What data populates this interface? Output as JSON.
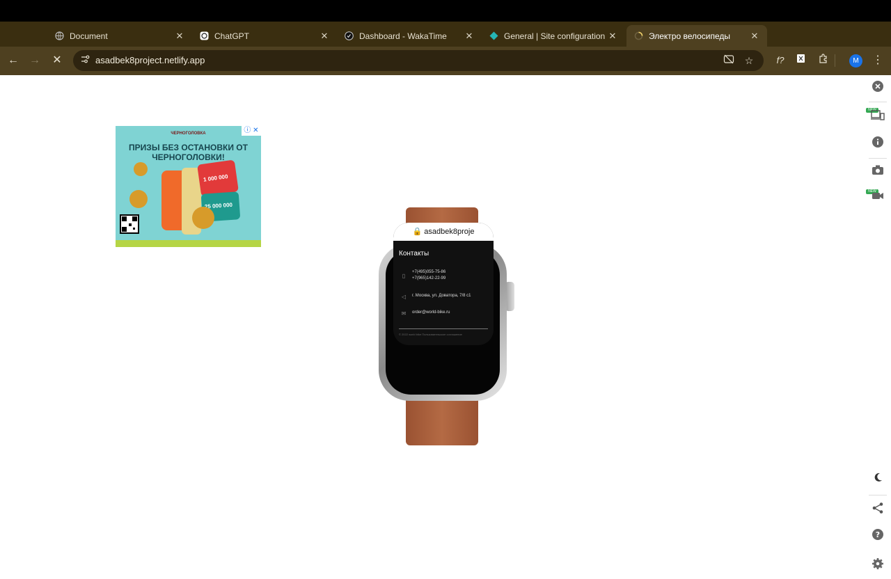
{
  "browser": {
    "tabs": [
      {
        "title": "Document",
        "icon": "globe-icon"
      },
      {
        "title": "ChatGPT",
        "icon": "chatgpt-icon"
      },
      {
        "title": "Dashboard - WakaTime",
        "icon": "wakatime-icon"
      },
      {
        "title": "General | Site configuration | ",
        "icon": "netlify-icon"
      },
      {
        "title": "Электро велосипеды",
        "icon": "loading-icon",
        "active": true
      }
    ],
    "url": "asadbek8project.netlify.app",
    "profile_initial": "M"
  },
  "ad": {
    "brand": "ЧЕРНОГОЛОВКА",
    "headline": "ПРИЗЫ БЕЗ ОСТАНОВКИ ОТ ЧЕРНОГОЛОВКИ!",
    "prize1": "1 000 000",
    "prize2": "25 000 000"
  },
  "watch": {
    "address": "asadbek8proje",
    "heading": "Контакты",
    "phone1": "+7(495)055-75-86",
    "phone2": "+7(965)142-22-99",
    "address_text": "г. Москва, ул. Доватора, 7/8 с1",
    "email": "order@world-bike.ru",
    "footer": "© 2022 world bike Пользовательское соглашение"
  },
  "sidebar": {
    "new_badge": "NEW",
    "icons": [
      "close-icon",
      "devices-icon",
      "info-icon",
      "camera-icon",
      "video-icon",
      "moon-icon",
      "share-icon",
      "help-icon",
      "settings-icon"
    ]
  },
  "colors": {
    "tabstrip": "#3a2e10",
    "toolbar": "#4e4020",
    "strap": "#a65c38"
  }
}
